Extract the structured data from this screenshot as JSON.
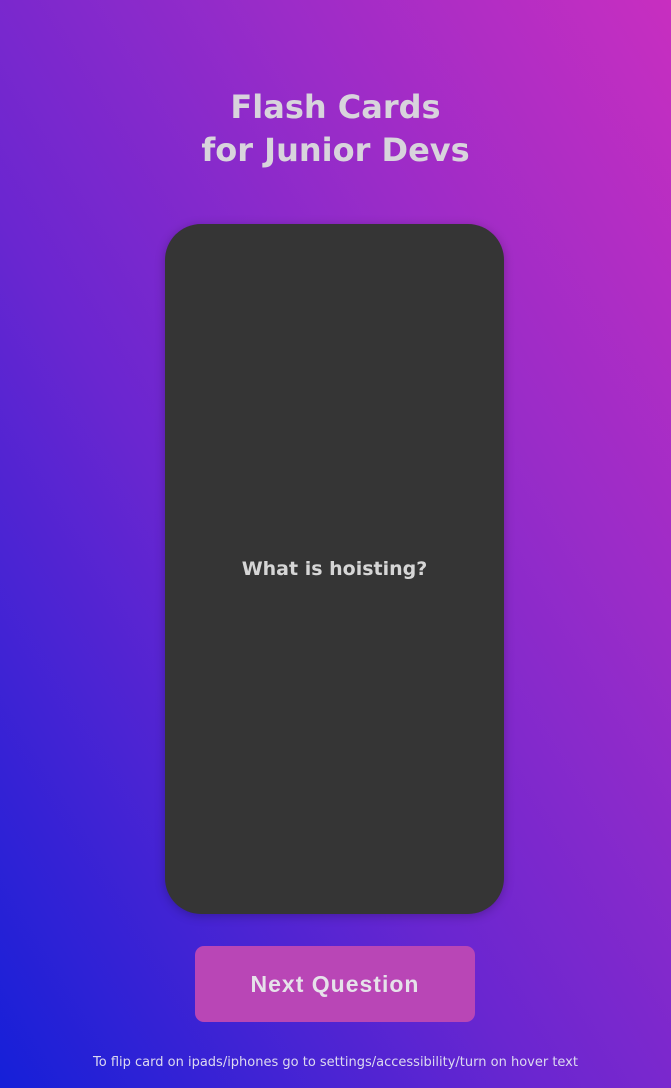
{
  "header": {
    "title_line1": "Flash Cards",
    "title_line2": "for Junior Devs"
  },
  "card": {
    "question": "What is hoisting?"
  },
  "controls": {
    "next_label": "Next Question"
  },
  "footer": {
    "hint": "To flip card on ipads/iphones go to settings/accessibility/turn on hover text"
  },
  "colors": {
    "card_background": "#353535",
    "button_background": "#b946b6",
    "gradient_start": "#1520d8",
    "gradient_end": "#c82ec0"
  }
}
